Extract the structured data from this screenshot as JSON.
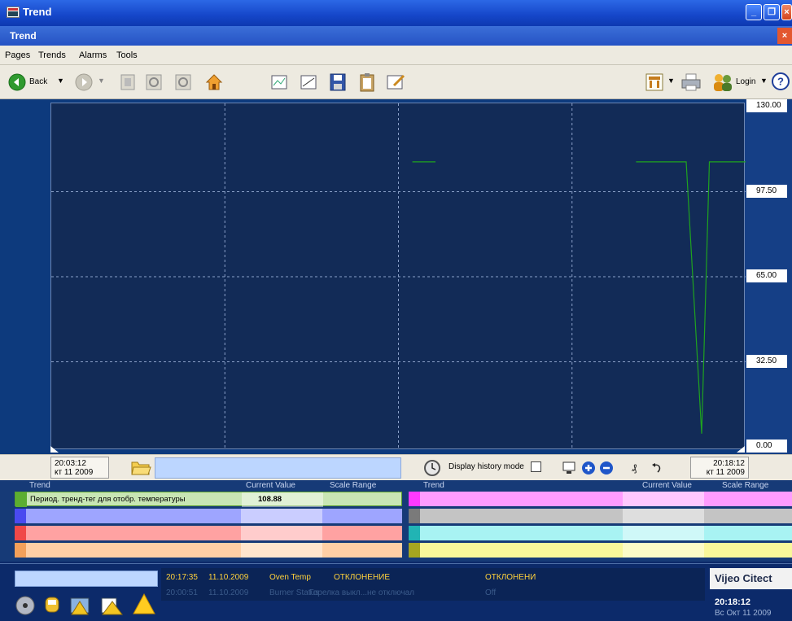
{
  "window": {
    "title": "Trend",
    "subtitle": "Trend"
  },
  "menu": [
    "Pages",
    "Trends",
    "Alarms",
    "Tools"
  ],
  "toolbar": {
    "back_label": "Back",
    "login_label": "Login"
  },
  "chart_data": {
    "type": "line",
    "ylim": [
      0,
      130
    ],
    "yticks": [
      "130.00",
      "97.50",
      "65.00",
      "32.50",
      "0.00"
    ],
    "xlim": [
      "20:03:12",
      "20:18:12"
    ],
    "grid": true,
    "series": [
      {
        "name": "Период. тренд-тег для отобр. температуры",
        "color": "#1fa31f",
        "x": [
          "20:11:00",
          "20:11:30",
          "20:15:50",
          "20:16:40",
          "20:16:55",
          "20:17:15",
          "20:17:25",
          "20:17:35",
          "20:18:12"
        ],
        "y": [
          108.88,
          108.88,
          108.88,
          108.88,
          108.88,
          5,
          108.88,
          108.88,
          108.88
        ],
        "segments": [
          [
            0,
            1
          ],
          [
            2,
            8
          ]
        ]
      }
    ]
  },
  "timebar": {
    "start_time": "20:03:12",
    "start_date": "кт 11 2009",
    "end_time": "20:18:12",
    "end_date": "кт 11 2009",
    "history_label": "Display history mode"
  },
  "pens": {
    "left_headers": {
      "trend": "Trend",
      "current": "Current Value",
      "range": "Scale Range"
    },
    "right_headers": {
      "trend": "Trend",
      "current": "Current Value",
      "range": "Scale Range"
    },
    "left": [
      {
        "name": "Период. тренд-тег для отобр. температуры",
        "value": "108.88",
        "color": "#5cae31",
        "bg": "#c8e6b4"
      },
      {
        "name": "",
        "value": "",
        "color": "#4a4af0",
        "bg": "#9ea5ff"
      },
      {
        "name": "",
        "value": "",
        "color": "#f04848",
        "bg": "#ffa2a2"
      },
      {
        "name": "",
        "value": "",
        "color": "#f3a05a",
        "bg": "#ffcfa5"
      }
    ],
    "right": [
      {
        "name": "",
        "value": "",
        "color": "#ff39ff",
        "bg": "#ff9cff"
      },
      {
        "name": "",
        "value": "",
        "color": "#7a7a7a",
        "bg": "#c4c4c4"
      },
      {
        "name": "",
        "value": "",
        "color": "#21b4b4",
        "bg": "#a8f3f3"
      },
      {
        "name": "",
        "value": "",
        "color": "#a6a620",
        "bg": "#f9f79a"
      }
    ]
  },
  "alarms": [
    {
      "time": "20:17:35",
      "date": "11.10.2009",
      "tag": "Oven Temp",
      "desc": "ОТКЛОНЕНИЕ",
      "state": "ОТКЛОНЕНИ"
    },
    {
      "time": "20:00:51",
      "date": "11.10.2009",
      "tag": "Burner Status",
      "desc": "Горелка выкл...не отключал",
      "state": "Off"
    }
  ],
  "brand": {
    "name": "Vijeo Citect",
    "clock": "20:18:12",
    "date": "Вс Окт 11 2009"
  }
}
